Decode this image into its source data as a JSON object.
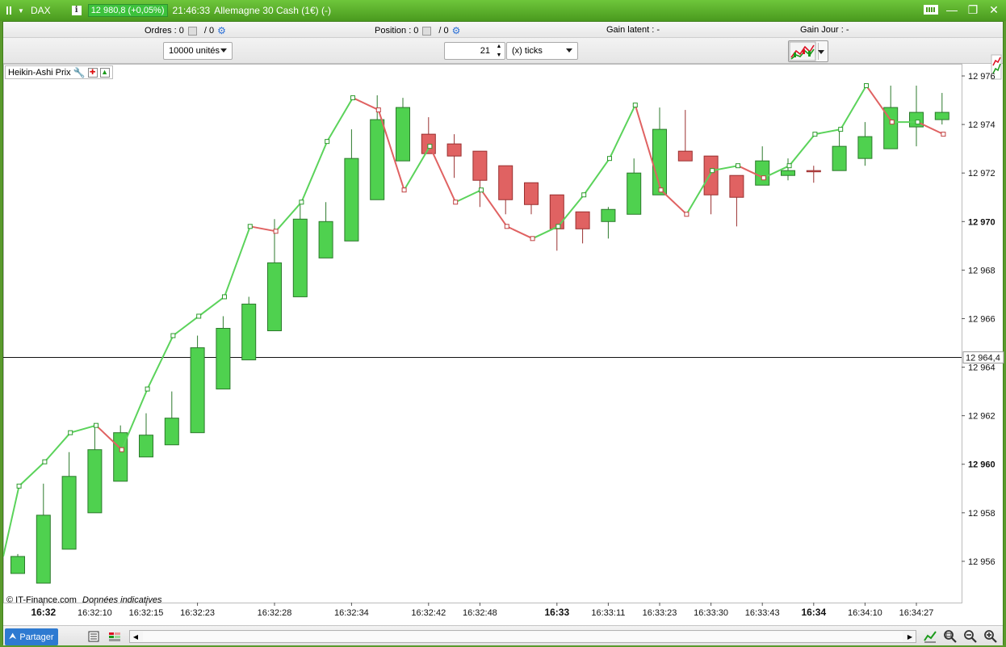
{
  "titlebar": {
    "symbol": "DAX",
    "info_label": "i",
    "price_badge": "12 980,8 (+0,05%)",
    "time": "21:46:33",
    "instrument": "Allemagne 30 Cash (1€) (-)",
    "minimize_label": "—",
    "restore_label": "❐",
    "close_label": "✕"
  },
  "infobar": {
    "orders_label": "Ordres :",
    "orders_value_1": "0",
    "orders_value_2": "/ 0",
    "position_label": "Position :",
    "position_value_1": "0",
    "position_value_2": "/ 0",
    "latent_label": "Gain latent :",
    "latent_value": "-",
    "day_label": "Gain Jour :",
    "day_value": "-"
  },
  "toolbar": {
    "quantity_select": "10000 unités",
    "ticks_value": "21",
    "ticks_unit_select": "(x) ticks"
  },
  "legend": {
    "label": "Heikin-Ashi Prix"
  },
  "footer": {
    "credit": "© IT-Finance.com",
    "note": "Données indicatives"
  },
  "bottombar": {
    "share_label": "Partager"
  },
  "colors": {
    "up": "#4fd14f",
    "down": "#e06262",
    "line_up": "#5bd35b",
    "line_down": "#e06262",
    "title_green": "#5bb02b"
  },
  "chart_data": {
    "type": "candlestick",
    "title": "",
    "ylim": [
      12954.3,
      12976.5
    ],
    "y_ticks": [
      {
        "v": 12976,
        "label": "12 976",
        "bold": false
      },
      {
        "v": 12974,
        "label": "12 974",
        "bold": false
      },
      {
        "v": 12972,
        "label": "12 972",
        "bold": false
      },
      {
        "v": 12970,
        "label": "12 970",
        "bold": true
      },
      {
        "v": 12968,
        "label": "12 968",
        "bold": false
      },
      {
        "v": 12966,
        "label": "12 966",
        "bold": false
      },
      {
        "v": 12964,
        "label": "12 964",
        "bold": false
      },
      {
        "v": 12962,
        "label": "12 962",
        "bold": false
      },
      {
        "v": 12960,
        "label": "12 960",
        "bold": true
      },
      {
        "v": 12958,
        "label": "12 958",
        "bold": false
      },
      {
        "v": 12956,
        "label": "12 956",
        "bold": false
      }
    ],
    "current_price": {
      "v": 12964.4,
      "label": "12 964,4"
    },
    "x_labels": [
      {
        "i": 1,
        "label": "16:32",
        "bold": true
      },
      {
        "i": 3,
        "label": "16:32:10",
        "bold": false
      },
      {
        "i": 5,
        "label": "16:32:15",
        "bold": false
      },
      {
        "i": 7,
        "label": "16:32:23",
        "bold": false
      },
      {
        "i": 10,
        "label": "16:32:28",
        "bold": false
      },
      {
        "i": 13,
        "label": "16:32:34",
        "bold": false
      },
      {
        "i": 16,
        "label": "16:32:42",
        "bold": false
      },
      {
        "i": 18,
        "label": "16:32:48",
        "bold": false
      },
      {
        "i": 21,
        "label": "16:33",
        "bold": true
      },
      {
        "i": 23,
        "label": "16:33:11",
        "bold": false
      },
      {
        "i": 25,
        "label": "16:33:23",
        "bold": false
      },
      {
        "i": 27,
        "label": "16:33:30",
        "bold": false
      },
      {
        "i": 29,
        "label": "16:33:43",
        "bold": false
      },
      {
        "i": 31,
        "label": "16:34",
        "bold": true
      },
      {
        "i": 33,
        "label": "16:34:10",
        "bold": false
      },
      {
        "i": 35,
        "label": "16:34:27",
        "bold": false
      }
    ],
    "candles": [
      {
        "o": 12955.5,
        "c": 12956.2,
        "h": 12956.3,
        "l": 12955.5
      },
      {
        "o": 12955.1,
        "c": 12957.9,
        "h": 12959.2,
        "l": 12955.1
      },
      {
        "o": 12956.5,
        "c": 12959.5,
        "h": 12960.5,
        "l": 12956.5
      },
      {
        "o": 12958.0,
        "c": 12960.6,
        "h": 12961.5,
        "l": 12958.0
      },
      {
        "o": 12959.3,
        "c": 12961.3,
        "h": 12961.6,
        "l": 12959.3
      },
      {
        "o": 12960.3,
        "c": 12961.2,
        "h": 12962.1,
        "l": 12960.3
      },
      {
        "o": 12960.8,
        "c": 12961.9,
        "h": 12963.0,
        "l": 12960.8
      },
      {
        "o": 12961.3,
        "c": 12964.8,
        "h": 12965.3,
        "l": 12961.3
      },
      {
        "o": 12963.1,
        "c": 12965.6,
        "h": 12966.1,
        "l": 12963.1
      },
      {
        "o": 12964.3,
        "c": 12966.6,
        "h": 12966.9,
        "l": 12964.3
      },
      {
        "o": 12965.5,
        "c": 12968.3,
        "h": 12970.1,
        "l": 12965.5
      },
      {
        "o": 12966.9,
        "c": 12970.1,
        "h": 12970.8,
        "l": 12966.9
      },
      {
        "o": 12968.5,
        "c": 12970.0,
        "h": 12970.8,
        "l": 12968.5
      },
      {
        "o": 12969.2,
        "c": 12972.6,
        "h": 12973.8,
        "l": 12969.2
      },
      {
        "o": 12970.9,
        "c": 12974.2,
        "h": 12975.2,
        "l": 12970.9
      },
      {
        "o": 12972.5,
        "c": 12974.7,
        "h": 12975.1,
        "l": 12972.5
      },
      {
        "o": 12973.6,
        "c": 12972.8,
        "h": 12974.3,
        "l": 12972.8
      },
      {
        "o": 12973.2,
        "c": 12972.7,
        "h": 12973.6,
        "l": 12971.8
      },
      {
        "o": 12972.9,
        "c": 12971.7,
        "h": 12972.9,
        "l": 12970.6
      },
      {
        "o": 12972.3,
        "c": 12970.9,
        "h": 12972.3,
        "l": 12970.3
      },
      {
        "o": 12971.6,
        "c": 12970.7,
        "h": 12971.6,
        "l": 12970.3
      },
      {
        "o": 12971.1,
        "c": 12969.7,
        "h": 12971.1,
        "l": 12968.8
      },
      {
        "o": 12970.4,
        "c": 12969.7,
        "h": 12970.4,
        "l": 12969.1
      },
      {
        "o": 12970.0,
        "c": 12970.5,
        "h": 12970.6,
        "l": 12969.3
      },
      {
        "o": 12970.3,
        "c": 12972.0,
        "h": 12972.6,
        "l": 12970.3
      },
      {
        "o": 12971.1,
        "c": 12973.8,
        "h": 12974.7,
        "l": 12971.1
      },
      {
        "o": 12972.9,
        "c": 12972.5,
        "h": 12974.6,
        "l": 12972.5
      },
      {
        "o": 12972.7,
        "c": 12971.1,
        "h": 12972.7,
        "l": 12970.3
      },
      {
        "o": 12971.9,
        "c": 12971.0,
        "h": 12971.9,
        "l": 12969.8
      },
      {
        "o": 12971.5,
        "c": 12972.5,
        "h": 12973.1,
        "l": 12971.5
      },
      {
        "o": 12971.9,
        "c": 12972.1,
        "h": 12972.6,
        "l": 12971.7
      },
      {
        "o": 12972.1,
        "c": 12972.05,
        "h": 12972.3,
        "l": 12971.6
      },
      {
        "o": 12972.1,
        "c": 12973.1,
        "h": 12973.8,
        "l": 12972.1
      },
      {
        "o": 12972.6,
        "c": 12973.5,
        "h": 12974.1,
        "l": 12972.3
      },
      {
        "o": 12973.0,
        "c": 12974.7,
        "h": 12975.6,
        "l": 12973.0
      },
      {
        "o": 12973.9,
        "c": 12974.5,
        "h": 12975.6,
        "l": 12973.1
      },
      {
        "o": 12974.2,
        "c": 12974.5,
        "h": 12975.3,
        "l": 12974.0
      }
    ],
    "close_line": [
      12956.2,
      12959.1,
      12960.1,
      12961.3,
      12961.6,
      12960.6,
      12963.1,
      12965.3,
      12966.1,
      12966.9,
      12969.8,
      12969.6,
      12970.8,
      12973.3,
      12975.1,
      12974.6,
      12971.3,
      12973.1,
      12970.8,
      12971.3,
      12969.8,
      12969.3,
      12969.8,
      12971.1,
      12972.6,
      12974.8,
      12971.3,
      12970.3,
      12972.1,
      12972.3,
      12971.8,
      12972.3,
      12973.6,
      12973.8,
      12975.6,
      12974.1,
      12974.1,
      12973.6
    ]
  }
}
